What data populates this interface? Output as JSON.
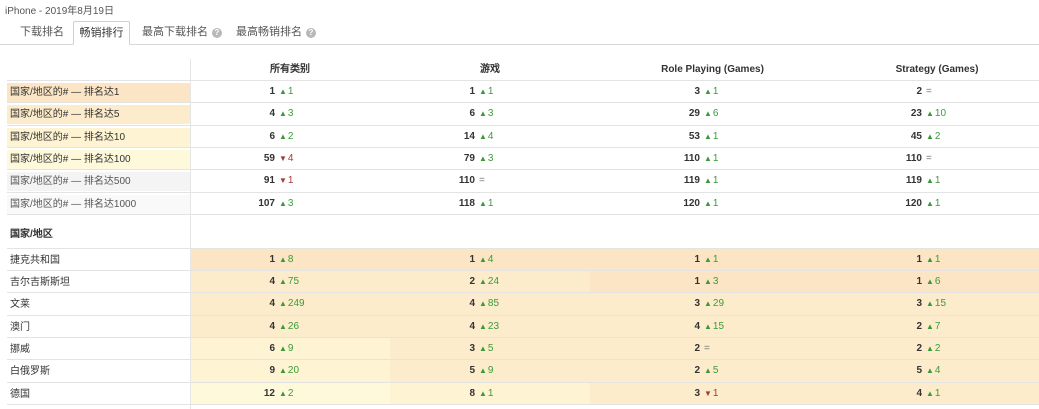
{
  "title": "iPhone - 2019年8月19日",
  "tabs": [
    {
      "label": "下载排名",
      "active": false,
      "help": false
    },
    {
      "label": "畅销排行",
      "active": true,
      "help": false
    },
    {
      "label": "最高下载排名",
      "active": false,
      "help": true
    },
    {
      "label": "最高畅销排名",
      "active": false,
      "help": true
    }
  ],
  "help_glyph": "?",
  "columns": [
    "所有类别",
    "游戏",
    "Role Playing (Games)",
    "Strategy (Games)"
  ],
  "colors": {
    "up": "#3a9a3a",
    "down": "#a23b3b",
    "same": "#777777",
    "rank1": "#fbe5c4",
    "rank5": "#fdeccb",
    "rank10": "#fef3d2",
    "rank100": "#fff9dc",
    "rank500": "#f4f4f4",
    "rank1000": "#f9f9f9"
  },
  "threshold_rows": [
    {
      "label": "国家/地区的# — 排名达1",
      "tier": "rank1",
      "cells": [
        {
          "value": "1",
          "dir": "up",
          "delta": "1"
        },
        {
          "value": "1",
          "dir": "up",
          "delta": "1"
        },
        {
          "value": "3",
          "dir": "up",
          "delta": "1"
        },
        {
          "value": "2",
          "dir": "same",
          "delta": "="
        }
      ]
    },
    {
      "label": "国家/地区的# — 排名达5",
      "tier": "rank5",
      "cells": [
        {
          "value": "4",
          "dir": "up",
          "delta": "3"
        },
        {
          "value": "6",
          "dir": "up",
          "delta": "3"
        },
        {
          "value": "29",
          "dir": "up",
          "delta": "6"
        },
        {
          "value": "23",
          "dir": "up",
          "delta": "10"
        }
      ]
    },
    {
      "label": "国家/地区的# — 排名达10",
      "tier": "rank10",
      "cells": [
        {
          "value": "6",
          "dir": "up",
          "delta": "2"
        },
        {
          "value": "14",
          "dir": "up",
          "delta": "4"
        },
        {
          "value": "53",
          "dir": "up",
          "delta": "1"
        },
        {
          "value": "45",
          "dir": "up",
          "delta": "2"
        }
      ]
    },
    {
      "label": "国家/地区的# — 排名达100",
      "tier": "rank100",
      "cells": [
        {
          "value": "59",
          "dir": "down",
          "delta": "4"
        },
        {
          "value": "79",
          "dir": "up",
          "delta": "3"
        },
        {
          "value": "110",
          "dir": "up",
          "delta": "1"
        },
        {
          "value": "110",
          "dir": "same",
          "delta": "="
        }
      ]
    },
    {
      "label": "国家/地区的# — 排名达500",
      "tier": "rank500",
      "cells": [
        {
          "value": "91",
          "dir": "down",
          "delta": "1"
        },
        {
          "value": "110",
          "dir": "same",
          "delta": "="
        },
        {
          "value": "119",
          "dir": "up",
          "delta": "1"
        },
        {
          "value": "119",
          "dir": "up",
          "delta": "1"
        }
      ]
    },
    {
      "label": "国家/地区的# — 排名达1000",
      "tier": "rank1000",
      "cells": [
        {
          "value": "107",
          "dir": "up",
          "delta": "3"
        },
        {
          "value": "118",
          "dir": "up",
          "delta": "1"
        },
        {
          "value": "120",
          "dir": "up",
          "delta": "1"
        },
        {
          "value": "120",
          "dir": "up",
          "delta": "1"
        }
      ]
    }
  ],
  "section_label": "国家/地区",
  "country_rows": [
    {
      "label": "捷克共和国",
      "cells": [
        {
          "value": "1",
          "dir": "up",
          "delta": "8",
          "tier": "rank1"
        },
        {
          "value": "1",
          "dir": "up",
          "delta": "4",
          "tier": "rank1"
        },
        {
          "value": "1",
          "dir": "up",
          "delta": "1",
          "tier": "rank1"
        },
        {
          "value": "1",
          "dir": "up",
          "delta": "1",
          "tier": "rank1"
        }
      ]
    },
    {
      "label": "吉尔吉斯斯坦",
      "cells": [
        {
          "value": "4",
          "dir": "up",
          "delta": "75",
          "tier": "rank5"
        },
        {
          "value": "2",
          "dir": "up",
          "delta": "24",
          "tier": "rank5"
        },
        {
          "value": "1",
          "dir": "up",
          "delta": "3",
          "tier": "rank1"
        },
        {
          "value": "1",
          "dir": "up",
          "delta": "6",
          "tier": "rank1"
        }
      ]
    },
    {
      "label": "文莱",
      "cells": [
        {
          "value": "4",
          "dir": "up",
          "delta": "249",
          "tier": "rank5"
        },
        {
          "value": "4",
          "dir": "up",
          "delta": "85",
          "tier": "rank5"
        },
        {
          "value": "3",
          "dir": "up",
          "delta": "29",
          "tier": "rank5"
        },
        {
          "value": "3",
          "dir": "up",
          "delta": "15",
          "tier": "rank5"
        }
      ]
    },
    {
      "label": "澳门",
      "cells": [
        {
          "value": "4",
          "dir": "up",
          "delta": "26",
          "tier": "rank5"
        },
        {
          "value": "4",
          "dir": "up",
          "delta": "23",
          "tier": "rank5"
        },
        {
          "value": "4",
          "dir": "up",
          "delta": "15",
          "tier": "rank5"
        },
        {
          "value": "2",
          "dir": "up",
          "delta": "7",
          "tier": "rank5"
        }
      ]
    },
    {
      "label": "挪威",
      "cells": [
        {
          "value": "6",
          "dir": "up",
          "delta": "9",
          "tier": "rank10"
        },
        {
          "value": "3",
          "dir": "up",
          "delta": "5",
          "tier": "rank5"
        },
        {
          "value": "2",
          "dir": "same",
          "delta": "=",
          "tier": "rank5"
        },
        {
          "value": "2",
          "dir": "up",
          "delta": "2",
          "tier": "rank5"
        }
      ]
    },
    {
      "label": "白俄罗斯",
      "cells": [
        {
          "value": "9",
          "dir": "up",
          "delta": "20",
          "tier": "rank10"
        },
        {
          "value": "5",
          "dir": "up",
          "delta": "9",
          "tier": "rank5"
        },
        {
          "value": "2",
          "dir": "up",
          "delta": "5",
          "tier": "rank5"
        },
        {
          "value": "5",
          "dir": "up",
          "delta": "4",
          "tier": "rank5"
        }
      ]
    },
    {
      "label": "德国",
      "cells": [
        {
          "value": "12",
          "dir": "up",
          "delta": "2",
          "tier": "rank100"
        },
        {
          "value": "8",
          "dir": "up",
          "delta": "1",
          "tier": "rank10"
        },
        {
          "value": "3",
          "dir": "down",
          "delta": "1",
          "tier": "rank5"
        },
        {
          "value": "4",
          "dir": "up",
          "delta": "1",
          "tier": "rank5"
        }
      ]
    }
  ]
}
